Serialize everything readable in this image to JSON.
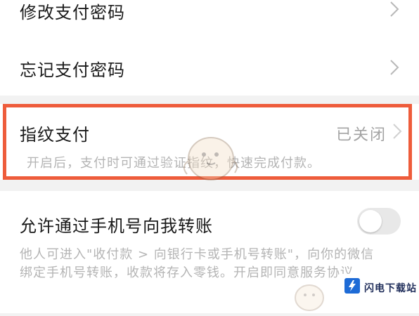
{
  "settings": {
    "change_password": {
      "title": "修改支付密码"
    },
    "forgot_password": {
      "title": "忘记支付密码"
    },
    "fingerprint": {
      "title": "指纹支付",
      "status": "已关闭",
      "description": "开启后，支付时可通过验证指纹，快速完成付款。"
    },
    "phone_transfer": {
      "title": "允许通过手机号向我转账",
      "enabled": false,
      "description_line1": "他人可进入\"收付款 > 向银行卡或手机号转账\"，向你的微信",
      "description_line2": "绑定手机号转账，收款将存入零钱。开启即同意服务协议"
    }
  },
  "colors": {
    "highlight_border": "#ee5c3b",
    "background": "#f2f2f2"
  },
  "watermark": {
    "text": "闪电下载站"
  }
}
